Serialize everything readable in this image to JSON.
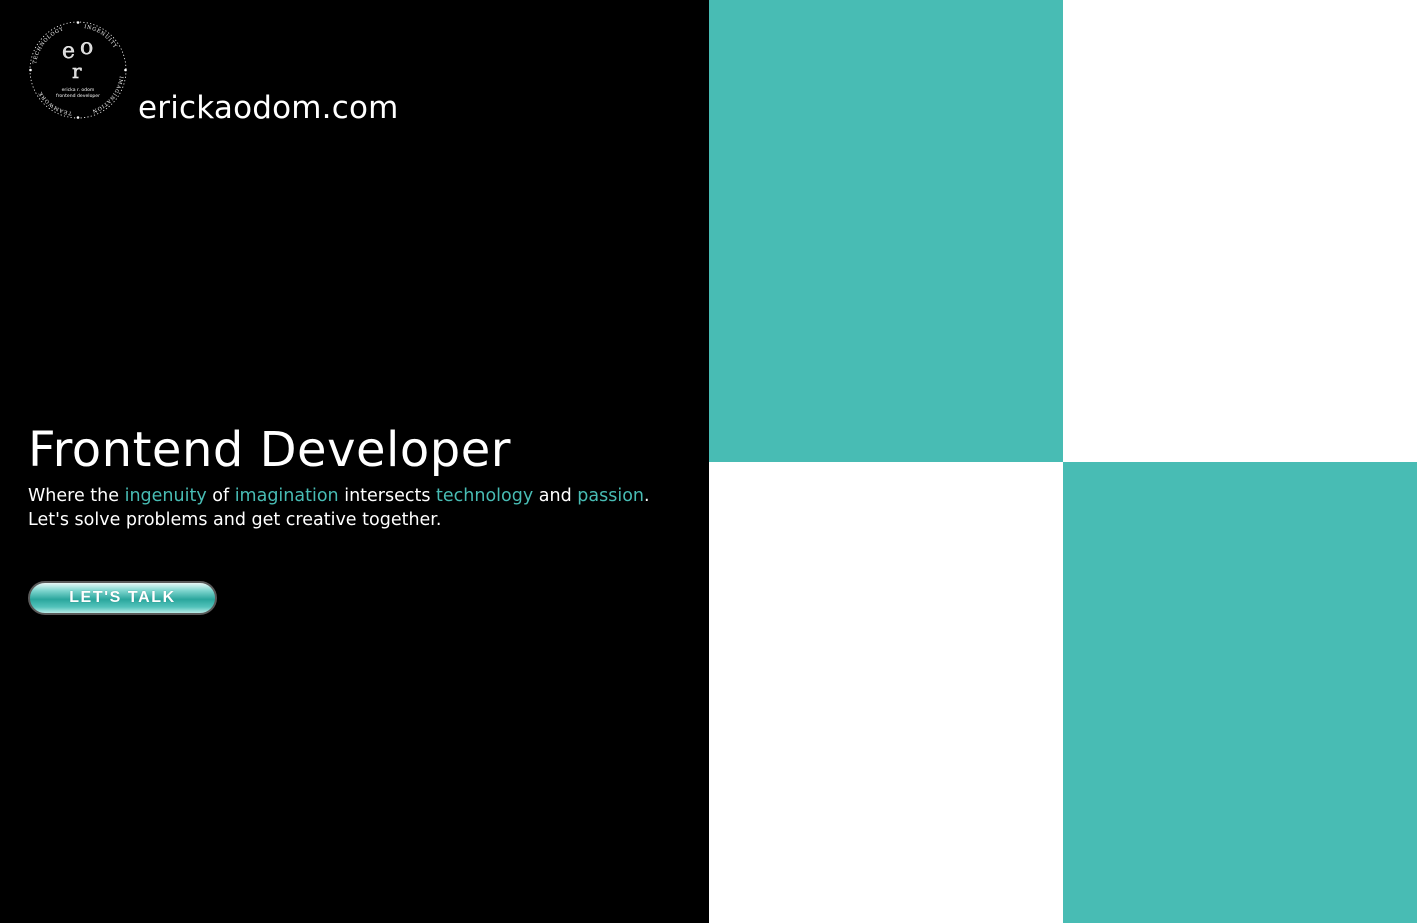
{
  "colors": {
    "accent": "#48bcb4",
    "background": "#000000",
    "text": "#ffffff",
    "panel": "#ffffff"
  },
  "logo": {
    "monogram": "eor",
    "ring_words": [
      "TECHNOLOGY",
      "INGENUITY",
      "TEAMWORK",
      "IMAGINATION"
    ],
    "name_line": "ericka r. odom",
    "role_line": "frontend developer"
  },
  "header": {
    "site_name": "erickaodom.com"
  },
  "hero": {
    "title": "Frontend Developer",
    "tagline": {
      "t1": "Where the ",
      "w1": "ingenuity",
      "t2": " of ",
      "w2": "imagination",
      "t3": " intersects ",
      "w3": "technology",
      "t4": " and ",
      "w4": "passion",
      "t5": "."
    },
    "line2": "Let's solve problems and get creative together.",
    "cta_label": "LET'S TALK"
  },
  "tiles": [
    {
      "position": "top-left",
      "color": "#48bcb4"
    },
    {
      "position": "top-right",
      "color": "#ffffff"
    },
    {
      "position": "bottom-left",
      "color": "#ffffff"
    },
    {
      "position": "bottom-right",
      "color": "#48bcb4"
    }
  ]
}
